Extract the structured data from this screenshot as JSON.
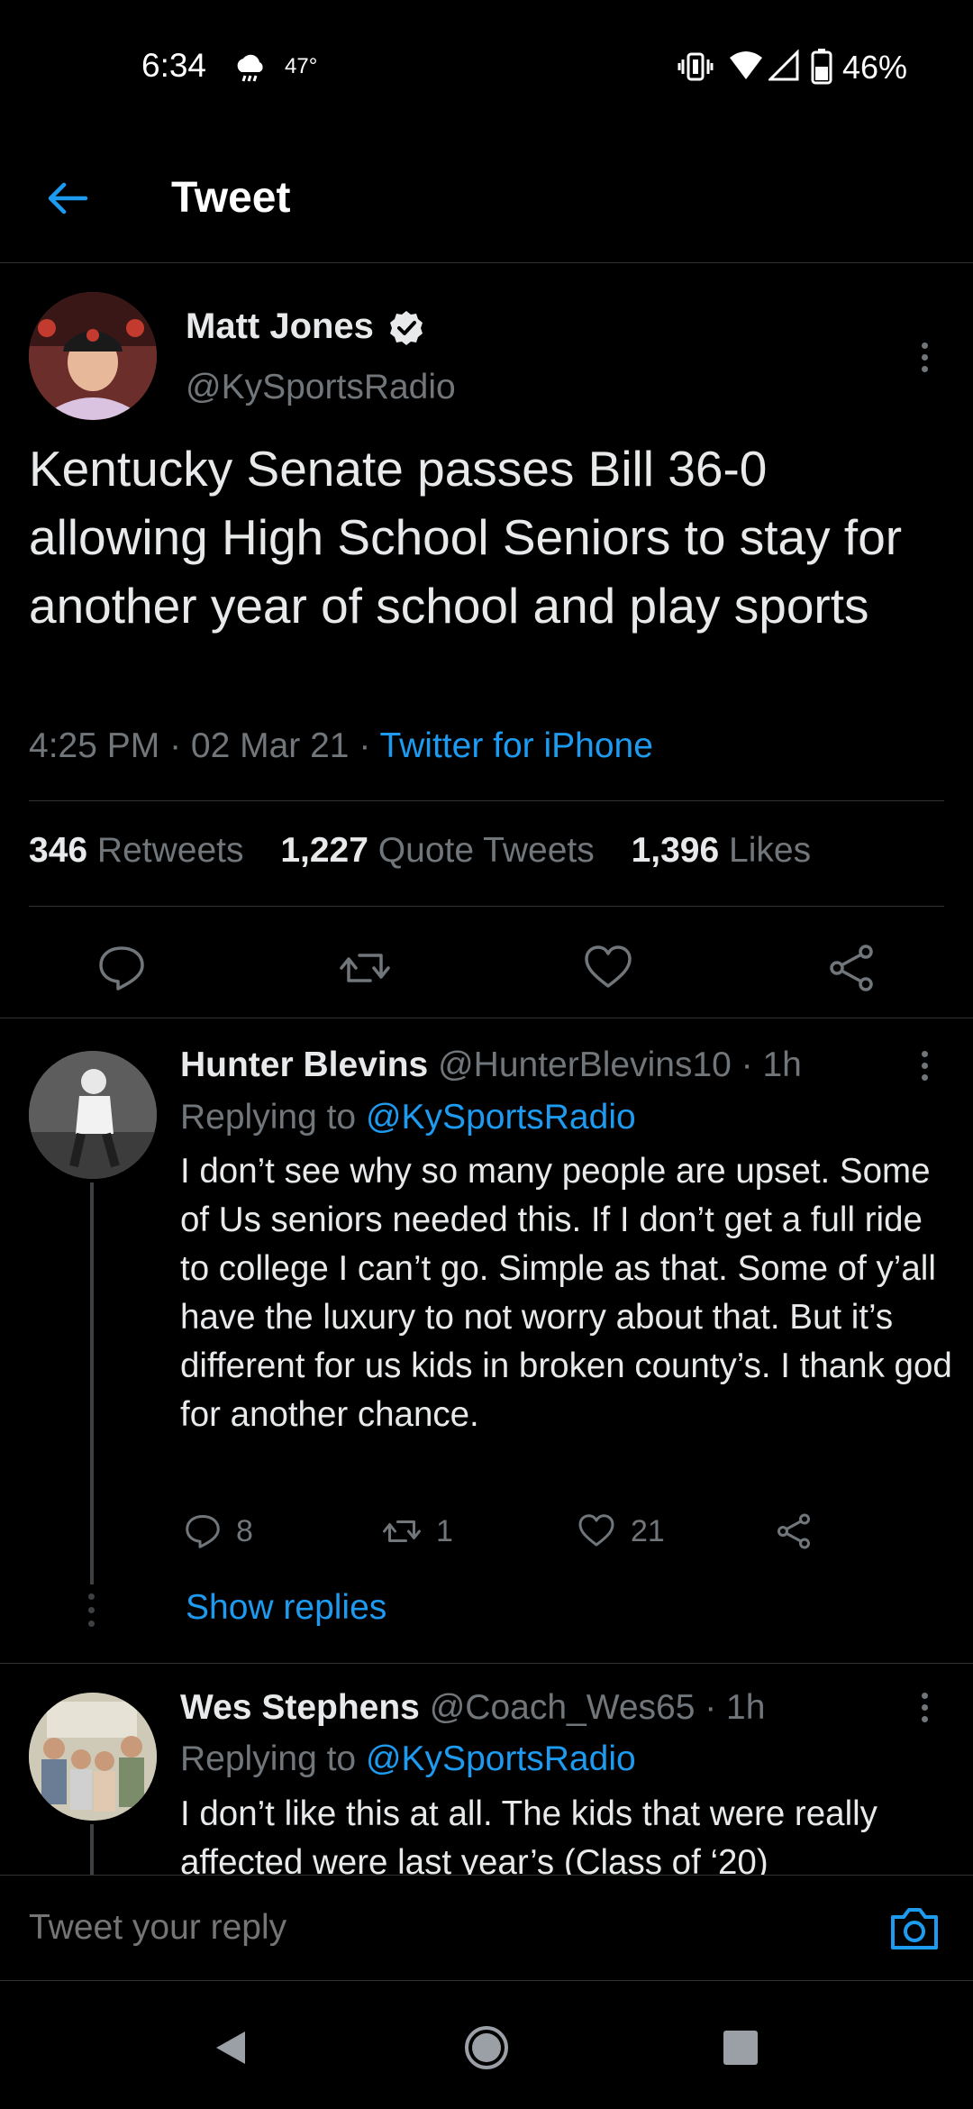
{
  "status_bar": {
    "time": "6:34",
    "temperature": "47°",
    "battery": "46%"
  },
  "header": {
    "title": "Tweet"
  },
  "tweet": {
    "author_name": "Matt Jones",
    "author_handle": "@KySportsRadio",
    "text": "Kentucky Senate passes Bill 36-0 allowing High School Seniors to stay for another year of school and play sports",
    "time": "4:25 PM · 02 Mar 21 · ",
    "source": "Twitter for iPhone",
    "stats": {
      "retweets_count": "346",
      "retweets_label": "Retweets",
      "quotes_count": "1,227",
      "quotes_label": "Quote Tweets",
      "likes_count": "1,396",
      "likes_label": "Likes"
    }
  },
  "replies": [
    {
      "name": "Hunter Blevins",
      "meta": " @HunterBlevins10 · 1h",
      "replying_prefix": "Replying to ",
      "replying_to": "@KySportsRadio",
      "text": "I don’t see why so many people are upset. Some of Us seniors needed this. If I don’t get a full ride to college I can’t go. Simple as that. Some of y’all have the luxury to not worry about that. But it’s different for us kids in broken county’s. I thank god for another chance.",
      "reply_count": "8",
      "retweet_count": "1",
      "like_count": "21",
      "show_replies": "Show replies"
    },
    {
      "name": "Wes Stephens",
      "meta": " @Coach_Wes65 · 1h",
      "replying_prefix": "Replying to ",
      "replying_to": "@KySportsRadio",
      "text": "I don’t like this at all. The kids that were really affected were last year’s (Class of ‘20)"
    }
  ],
  "composer": {
    "placeholder": "Tweet your reply"
  },
  "colors": {
    "accent": "#1d9bf0",
    "muted": "#71767b",
    "background": "#000000"
  },
  "icons": [
    "back-arrow-icon",
    "verified-icon",
    "more-icon",
    "reply-icon",
    "retweet-icon",
    "like-icon",
    "share-icon",
    "camera-icon",
    "nav-back-icon",
    "nav-home-icon",
    "nav-recents-icon"
  ]
}
